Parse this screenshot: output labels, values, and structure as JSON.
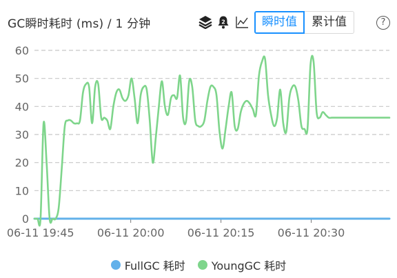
{
  "header": {
    "title": "GC瞬时耗时 (ms) / 1 分钟",
    "toggle": {
      "instant_label": "瞬时值",
      "cumulative_label": "累计值",
      "active": "instant"
    },
    "help_label": "?"
  },
  "icons": {
    "layers": "layers-icon",
    "alert": "alert-bell-icon",
    "line": "line-chart-icon",
    "help": "question-circle-icon"
  },
  "colors": {
    "accent": "#1890ff",
    "young": "#7ed58b",
    "full": "#62b1ea",
    "grid": "#c8c8c8",
    "axis": "#666666"
  },
  "chart_data": {
    "type": "line",
    "title": "GC瞬时耗时 (ms) / 1 分钟",
    "ylim": [
      0,
      60
    ],
    "yticks": [
      0,
      10,
      20,
      30,
      40,
      50,
      60
    ],
    "grid": true,
    "legend_position": "bottom",
    "xtick_labels": [
      "06-11 19:45",
      "06-11 20:00",
      "06-11 20:15",
      "06-11 20:30"
    ],
    "x_start": "06-11 19:44",
    "x_end": "06-11 20:43",
    "series": [
      {
        "name": "FullGC 耗时",
        "color": "#62b1ea",
        "values": [
          0,
          0,
          0,
          0,
          0,
          0,
          0,
          0,
          0,
          0,
          0,
          0,
          0,
          0,
          0,
          0,
          0,
          0,
          0,
          0,
          0,
          0,
          0,
          0,
          0,
          0,
          0,
          0,
          0,
          0,
          0,
          0,
          0,
          0,
          0,
          0,
          0,
          0,
          0,
          0,
          0,
          0,
          0,
          0,
          0,
          0,
          0,
          0,
          0,
          0,
          0,
          0,
          0,
          0,
          0,
          0,
          0,
          0,
          0,
          0,
          0,
          0,
          0,
          0,
          0,
          0,
          0,
          0,
          0,
          0,
          0,
          0,
          0,
          0,
          0,
          0,
          0,
          0,
          0,
          0,
          0,
          0,
          0,
          0,
          0,
          0,
          0,
          0,
          0,
          0,
          0,
          0,
          0,
          0,
          0,
          0,
          0,
          0,
          0,
          0,
          0,
          0,
          0,
          0,
          0,
          0,
          0,
          0,
          0,
          0,
          0,
          0,
          0,
          0,
          0,
          0,
          0,
          0
        ]
      },
      {
        "name": "YoungGC 耗时",
        "color": "#7ed58b",
        "values": [
          0,
          0,
          0,
          34,
          20,
          0,
          0,
          0,
          4,
          18,
          33,
          35,
          35,
          34,
          34,
          35,
          45,
          48,
          47,
          34,
          47,
          48,
          36,
          36,
          35,
          32,
          40,
          45,
          46,
          43,
          42,
          44,
          50,
          43,
          34,
          44,
          47,
          46,
          35,
          20,
          29,
          40,
          49,
          40,
          37,
          43,
          44,
          43,
          51,
          36,
          35,
          49,
          47,
          35,
          33,
          33,
          35,
          42,
          47,
          47,
          44,
          31,
          25,
          32,
          40,
          45,
          33,
          32,
          38,
          41,
          42,
          41,
          39,
          37,
          51,
          56,
          57,
          44,
          37,
          33,
          36,
          46,
          34,
          31,
          43,
          47,
          47,
          42,
          33,
          32,
          32,
          55,
          56,
          38,
          36,
          38,
          37,
          36,
          36,
          36,
          36,
          36,
          36,
          36,
          36,
          36,
          36,
          36,
          36,
          36,
          36,
          36,
          36,
          36,
          36,
          36,
          36,
          36
        ]
      }
    ]
  }
}
